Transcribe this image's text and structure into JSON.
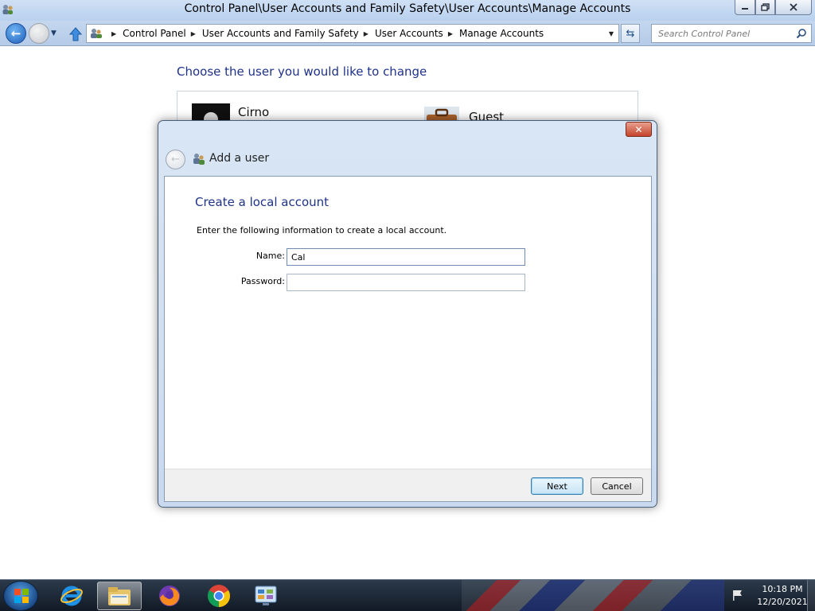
{
  "window": {
    "title": "Control Panel\\User Accounts and Family Safety\\User Accounts\\Manage Accounts",
    "minimize_icon": "minimize-icon",
    "maximize_icon": "restore-icon",
    "close_icon": "close-icon"
  },
  "navigation": {
    "breadcrumbs": [
      "Control Panel",
      "User Accounts and Family Safety",
      "User Accounts",
      "Manage Accounts"
    ],
    "search_placeholder": "Search Control Panel"
  },
  "content": {
    "heading": "Choose the user you would like to change",
    "accounts": [
      {
        "name": "Cirno",
        "picture": "dark-silhouette"
      },
      {
        "name": "Guest",
        "picture": "briefcase"
      }
    ]
  },
  "dialog": {
    "title": "Add a user",
    "section_title": "Create a local account",
    "instruction": "Enter the following information to create a local account.",
    "name_label": "Name:",
    "name_value": "Cal",
    "password_label": "Password:",
    "password_value": "",
    "next_label": "Next",
    "cancel_label": "Cancel"
  },
  "taskbar": {
    "items": [
      "start-orb",
      "internet-explorer",
      "windows-explorer",
      "firefox",
      "chrome",
      "control-panel"
    ],
    "active_item": "windows-explorer",
    "time": "10:18 PM",
    "date": "12/20/2021"
  },
  "colors": {
    "heading_blue": "#1e3287",
    "titlebar": "#b9d1ee",
    "taskbar": "#1b2633",
    "dialog_close": "#c5452b"
  }
}
